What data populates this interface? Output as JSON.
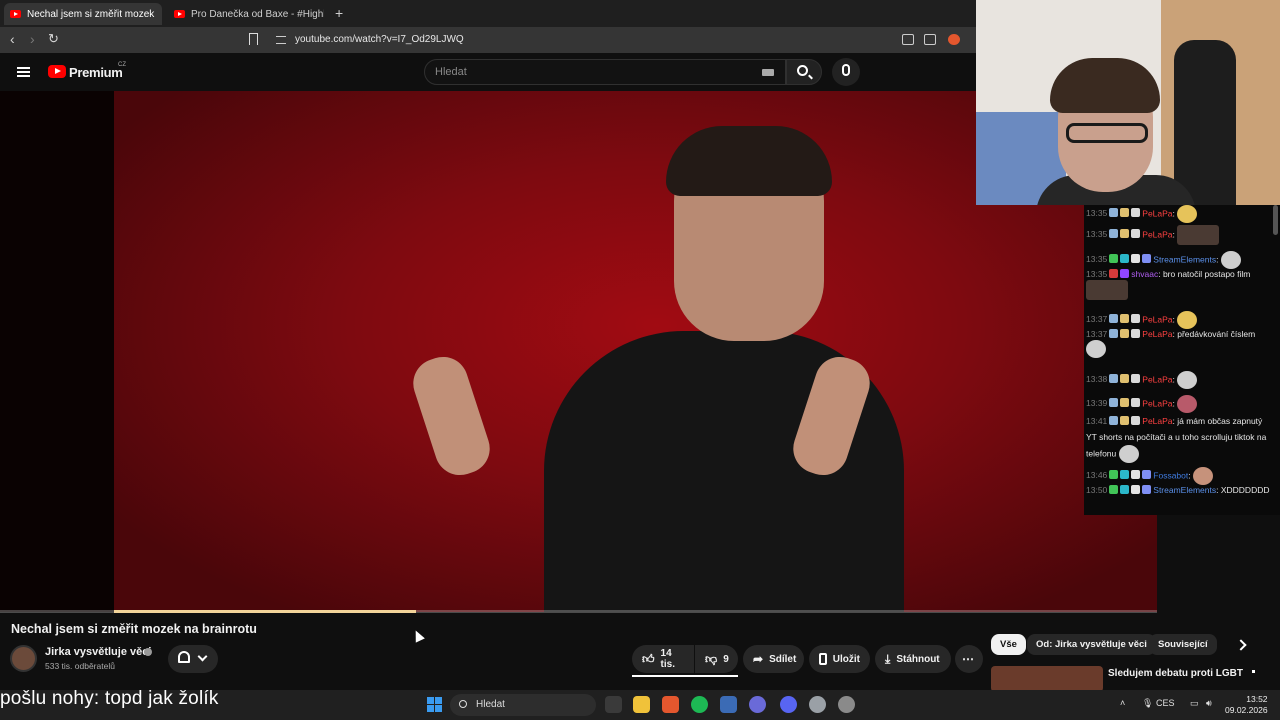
{
  "browser": {
    "tabs": [
      {
        "label": "Nechal jsem si změřit mozek"
      },
      {
        "label": "Pro Danečka od Baxe - #Highlights"
      }
    ],
    "url": "youtube.com/watch?v=I7_Od29LJWQ"
  },
  "youtube": {
    "brand": "Premium",
    "region": "CZ",
    "search_placeholder": "Hledat"
  },
  "video": {
    "title": "Nechal jsem si změřit mozek na brainrotu",
    "progress_fraction": 0.29,
    "channel": {
      "name": "Jirka vysvětluje věci",
      "subscribers": "533 tis. odběratelů"
    },
    "actions": {
      "likes": "14 tis.",
      "dislikes": "9",
      "share": "Sdílet",
      "save": "Uložit",
      "download": "Stáhnout"
    }
  },
  "chips": [
    "Vše",
    "Od: Jirka vysvětluje věci",
    "Související"
  ],
  "related": {
    "title": "Sledujem debatu proti LGBT"
  },
  "chat": [
    {
      "time": "13:35",
      "user": "PeLaPa",
      "text": ":"
    },
    {
      "time": "13:35",
      "user": "PeLaPa",
      "text": ":"
    },
    {
      "time": "13:35",
      "user": "StreamElements",
      "text": ":"
    },
    {
      "time": "13:35",
      "user": "shvaac",
      "text": ": bro natočil postapo film"
    },
    {
      "time": "13:37",
      "user": "PeLaPa",
      "text": ":"
    },
    {
      "time": "13:37",
      "user": "PeLaPa",
      "text": ": předávkování číslem"
    },
    {
      "time": "13:38",
      "user": "PeLaPa",
      "text": ":"
    },
    {
      "time": "13:39",
      "user": "PeLaPa",
      "text": ":"
    },
    {
      "time": "13:41",
      "user": "PeLaPa",
      "text": ": já mám občas zapnutý YT shorts na počítači a u toho scrolluju tiktok na telefonu"
    },
    {
      "time": "13:46",
      "user": "Fossabot",
      "text": ":"
    },
    {
      "time": "13:50",
      "user": "StreamElements",
      "text": ": XDDDDDDD"
    }
  ],
  "subtitle": "pošlu nohy: topd jak žolík",
  "taskbar": {
    "search": "Hledat",
    "lang": "CES",
    "time": "13:52",
    "date": "09.02.2026"
  },
  "colors": {
    "accent": "#ff0000",
    "progress": "#f3d49a",
    "chat_user": "#ff4141"
  }
}
